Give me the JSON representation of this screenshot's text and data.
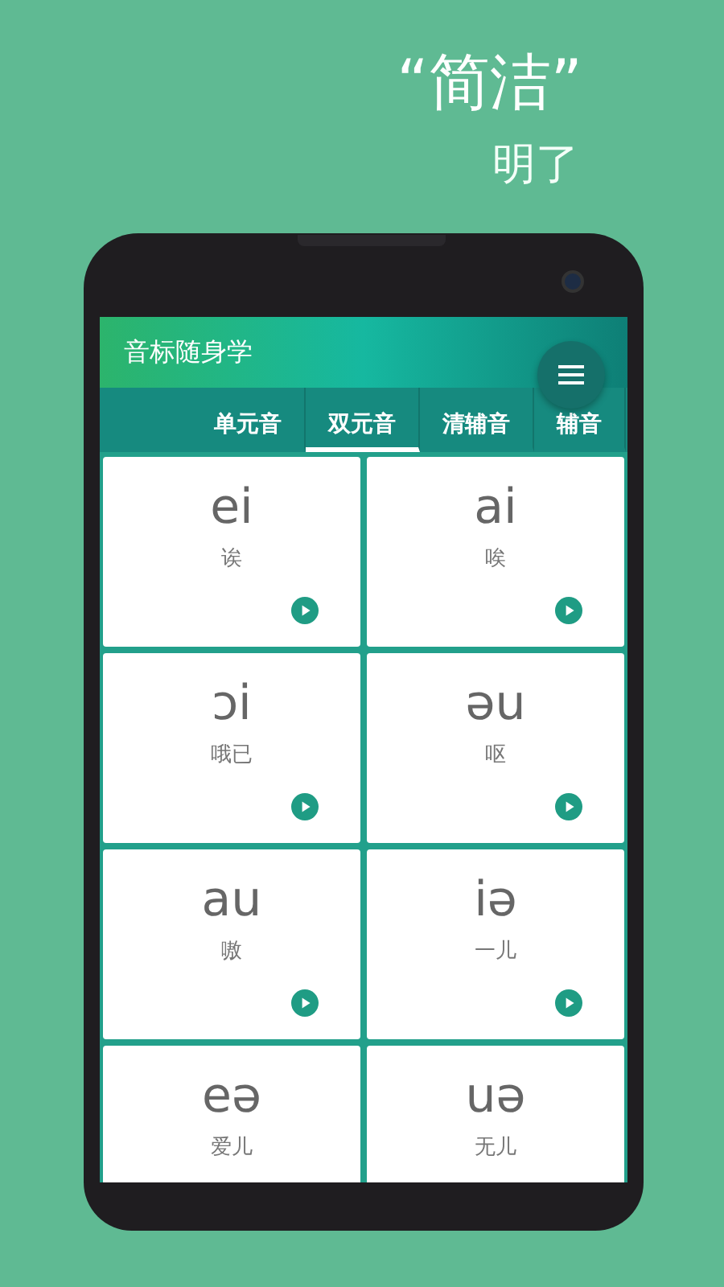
{
  "headline": {
    "title": "“简洁”",
    "subtitle": "明了"
  },
  "app_bar": {
    "title": "音标随身学"
  },
  "tabs": [
    {
      "label": "单元音",
      "selected": false
    },
    {
      "label": "双元音",
      "selected": true
    },
    {
      "label": "清辅音",
      "selected": false
    },
    {
      "label": "辅音",
      "selected": false
    }
  ],
  "cards": [
    {
      "symbol": "ei",
      "hint": "诶"
    },
    {
      "symbol": "ai",
      "hint": "唉"
    },
    {
      "symbol": "ɔi",
      "hint": "哦已"
    },
    {
      "symbol": "əu",
      "hint": "呕"
    },
    {
      "symbol": "au",
      "hint": "嗷"
    },
    {
      "symbol": "iə",
      "hint": "一儿"
    },
    {
      "symbol": "eə",
      "hint": "爱儿"
    },
    {
      "symbol": "uə",
      "hint": "无儿"
    }
  ]
}
